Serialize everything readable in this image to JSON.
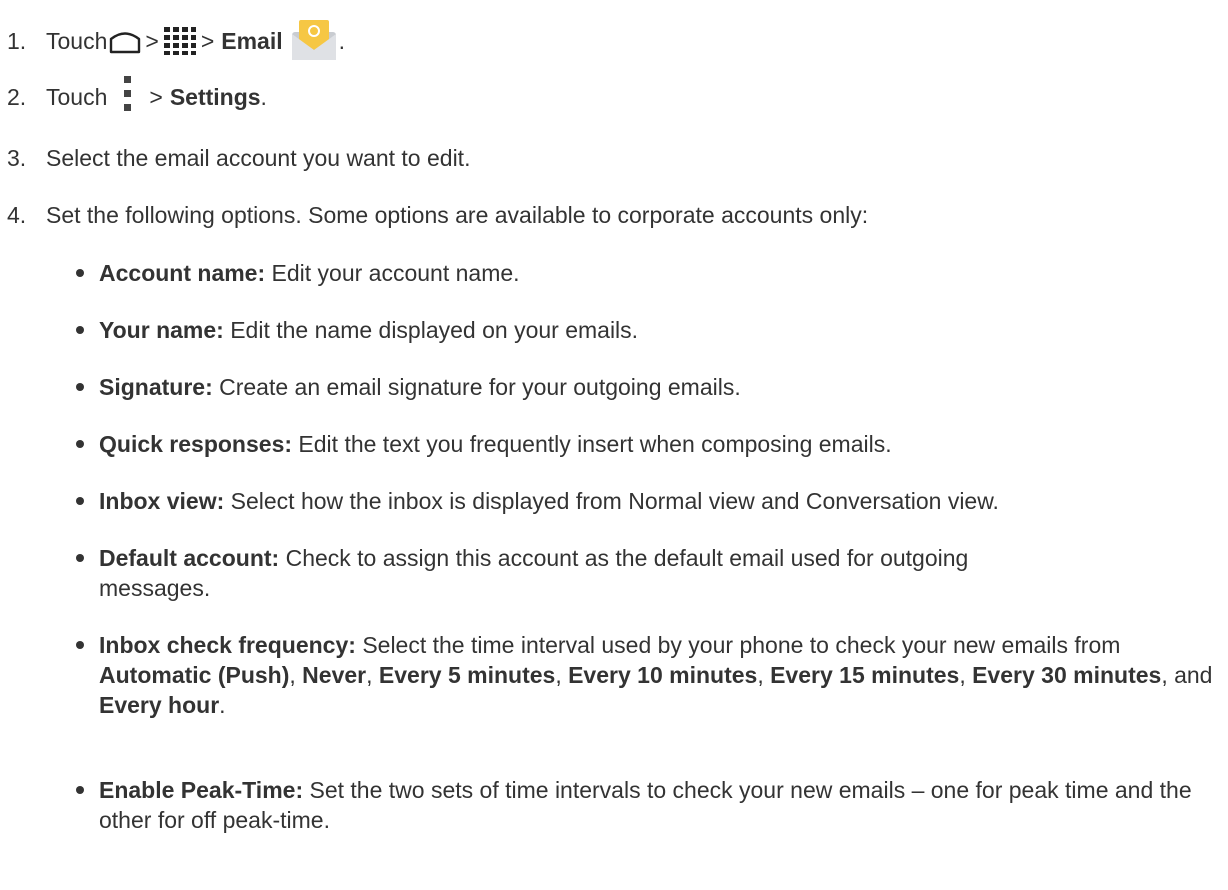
{
  "steps": [
    {
      "num": "1.",
      "pre": "Touch",
      "sep1": ">",
      "sep2": ">",
      "email": "Email",
      "end": "."
    },
    {
      "num": "2.",
      "pre": "Touch",
      "sep": ">",
      "settings": "Settings",
      "end": "."
    },
    {
      "num": "3.",
      "text": "Select the email account you want to edit."
    },
    {
      "num": "4.",
      "text": "Set the following options. Some options are available to corporate accounts only:"
    }
  ],
  "options": [
    {
      "label": "Account name:",
      "desc": "Edit your account name."
    },
    {
      "label": "Your name:",
      "desc": "Edit the name displayed on your emails."
    },
    {
      "label": "Signature:",
      "desc": "Create an email signature for your outgoing emails."
    },
    {
      "label": "Quick responses:",
      "desc": "Edit the text you frequently insert when composing emails."
    },
    {
      "label": "Inbox view:",
      "desc": "Select how the inbox is displayed from Normal view and Conversation view."
    },
    {
      "label": "Default account:",
      "desc": "Check to assign this account as the default email used for outgoing messages."
    },
    {
      "label": "Inbox check frequency:",
      "desc": "Select the time interval used by your phone to check your new emails from",
      "choices": [
        "Automatic (Push)",
        "Never",
        "Every 5 minutes",
        "Every 10 minutes",
        "Every 15 minutes",
        "Every 30 minutes",
        "Every hour"
      ],
      "sep": ",",
      "and": ", and",
      "end": "."
    },
    {
      "label": "Enable Peak-Time:",
      "desc": "Set the two sets of time intervals to check your new emails – one for peak time and the other for off peak-time."
    }
  ],
  "icons": {
    "home": "home-outline-icon",
    "apps": "apps-grid-icon",
    "email": "email-app-icon",
    "menu": "menu-overflow-icon"
  },
  "colors": {
    "text": "#333333",
    "email_yellow": "#f6c744",
    "email_gray": "#c9ccd1"
  }
}
